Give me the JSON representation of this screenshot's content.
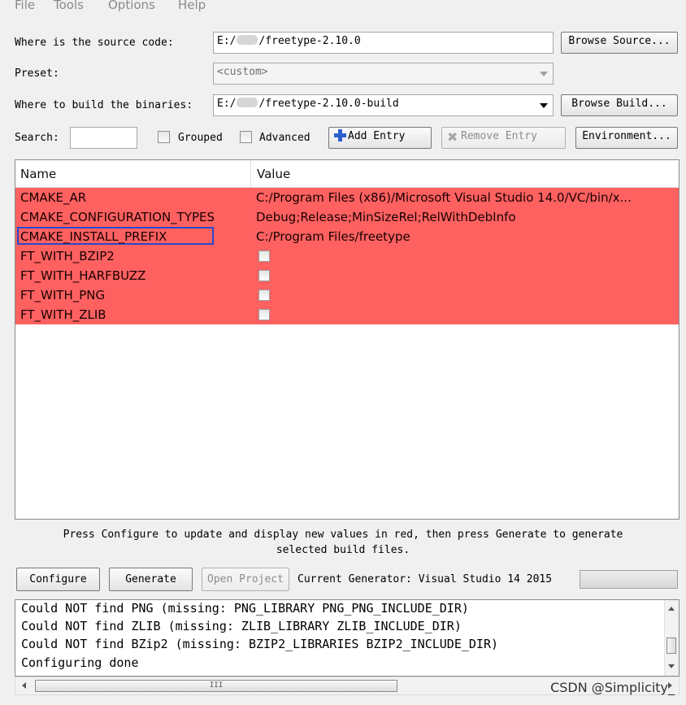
{
  "menu": [
    "File",
    "Tools",
    "Options",
    "Help"
  ],
  "source": {
    "label": "Where is the source code:",
    "prefix": "E:/",
    "suffix": "/freetype-2.10.0",
    "button": "Browse Source..."
  },
  "preset": {
    "label": "Preset:",
    "value": "<custom>"
  },
  "build": {
    "label": "Where to build the binaries:",
    "prefix": "E:/",
    "suffix": "/freetype-2.10.0-build",
    "button": "Browse Build..."
  },
  "toolbar": {
    "search_label": "Search:",
    "search_value": "",
    "grouped_label": "Grouped",
    "advanced_label": "Advanced",
    "add_entry": "Add Entry",
    "remove_entry": "Remove Entry",
    "environment": "Environment..."
  },
  "table": {
    "headers": [
      "Name",
      "Value"
    ],
    "rows": [
      {
        "name": "CMAKE_AR",
        "value": "C:/Program Files (x86)/Microsoft Visual Studio 14.0/VC/bin/x...",
        "checkbox": false
      },
      {
        "name": "CMAKE_CONFIGURATION_TYPES",
        "value": "Debug;Release;MinSizeRel;RelWithDebInfo",
        "checkbox": false
      },
      {
        "name": "CMAKE_INSTALL_PREFIX",
        "value": "C:/Program Files/freetype",
        "checkbox": false
      },
      {
        "name": "FT_WITH_BZIP2",
        "value": "",
        "checkbox": true
      },
      {
        "name": "FT_WITH_HARFBUZZ",
        "value": "",
        "checkbox": true
      },
      {
        "name": "FT_WITH_PNG",
        "value": "",
        "checkbox": true
      },
      {
        "name": "FT_WITH_ZLIB",
        "value": "",
        "checkbox": true
      }
    ],
    "highlight_color": "#ff6161"
  },
  "hint": {
    "line1": "Press Configure to update and display new values in red, then press Generate to generate",
    "line2": "selected build files."
  },
  "actions": {
    "configure": "Configure",
    "generate": "Generate",
    "open_project": "Open Project",
    "generator": "Current Generator: Visual Studio 14 2015"
  },
  "output": [
    "Could NOT find PNG (missing: PNG_LIBRARY PNG_PNG_INCLUDE_DIR)",
    "Could NOT find ZLIB (missing: ZLIB_LIBRARY ZLIB_INCLUDE_DIR)",
    "Could NOT find BZip2 (missing: BZIP2_LIBRARIES BZIP2_INCLUDE_DIR)",
    "Configuring done"
  ],
  "scroll_grip": "III",
  "watermark": "CSDN @Simplicity_"
}
